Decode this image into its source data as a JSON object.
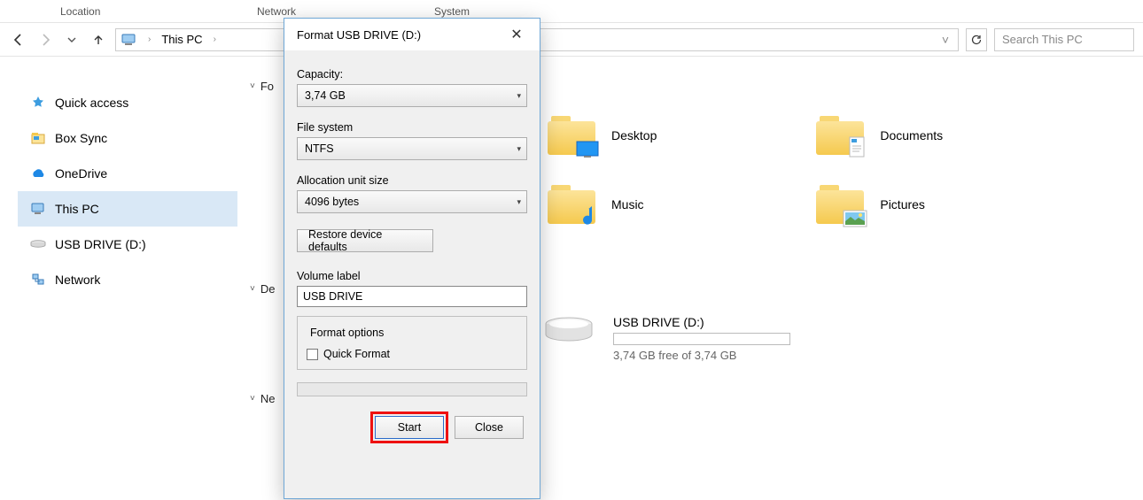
{
  "colheaders": {
    "location": "Location",
    "network": "Network",
    "system": "System"
  },
  "breadcrumb": {
    "root": "This PC"
  },
  "search": {
    "placeholder": "Search This PC"
  },
  "sidebar": {
    "items": [
      {
        "label": "Quick access"
      },
      {
        "label": "Box Sync"
      },
      {
        "label": "OneDrive"
      },
      {
        "label": "This PC"
      },
      {
        "label": "USB DRIVE (D:)"
      },
      {
        "label": "Network"
      }
    ]
  },
  "groups": {
    "folders_label": "Fo",
    "devices_label": "De",
    "network_label": "Ne"
  },
  "folders": [
    {
      "label": "Desktop"
    },
    {
      "label": "Documents"
    },
    {
      "label": "Music"
    },
    {
      "label": "Pictures"
    }
  ],
  "drive": {
    "name": "USB DRIVE (D:)",
    "free_text": "3,74 GB free of 3,74 GB"
  },
  "dialog": {
    "title": "Format USB DRIVE (D:)",
    "capacity_label": "Capacity:",
    "capacity_value": "3,74 GB",
    "fs_label": "File system",
    "fs_value": "NTFS",
    "alloc_label": "Allocation unit size",
    "alloc_value": "4096 bytes",
    "restore_label": "Restore device defaults",
    "vol_label": "Volume label",
    "vol_value": "USB DRIVE",
    "fmt_options_label": "Format options",
    "quick_format_label": "Quick Format",
    "start_label": "Start",
    "close_label": "Close"
  }
}
